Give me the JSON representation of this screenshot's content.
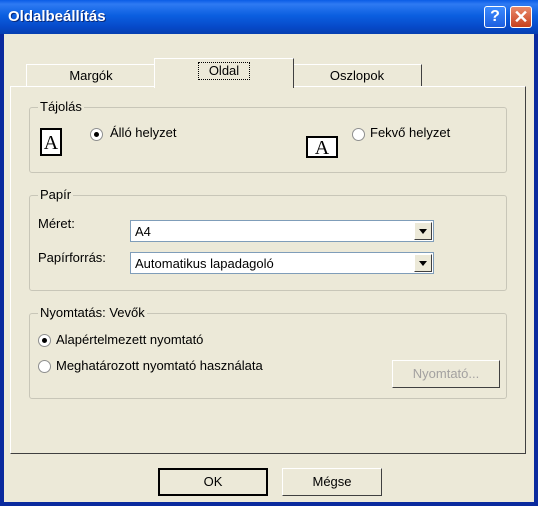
{
  "window": {
    "title": "Oldalbeállítás",
    "help_glyph": "?",
    "close_glyph": "✕"
  },
  "tabs": [
    {
      "label": "Margók"
    },
    {
      "label": "Oldal"
    },
    {
      "label": "Oszlopok"
    }
  ],
  "orientation": {
    "legend": "Tájolás",
    "portrait_label": "Álló helyzet",
    "portrait_icon": "A",
    "landscape_label": "Fekvő helyzet",
    "landscape_icon": "A",
    "selected": "portrait"
  },
  "paper": {
    "legend": "Papír",
    "size_label": "Méret:",
    "size_value": "A4",
    "source_label": "Papírforrás:",
    "source_value": "Automatikus lapadagoló"
  },
  "printing": {
    "legend": "Nyomtatás: Vevők",
    "default_label": "Alapértelmezett nyomtató",
    "specific_label": "Meghatározott nyomtató használata",
    "printer_button": "Nyomtató...",
    "selected": "default"
  },
  "footer": {
    "ok_label": "OK",
    "cancel_label": "Mégse"
  },
  "colors": {
    "title_bar": "#0b5fe0",
    "dialog_bg": "#ece9d8",
    "close_button": "#c8401c"
  },
  "icons": {
    "help": "help-icon",
    "close": "close-icon",
    "dropdown": "chevron-down-icon"
  }
}
